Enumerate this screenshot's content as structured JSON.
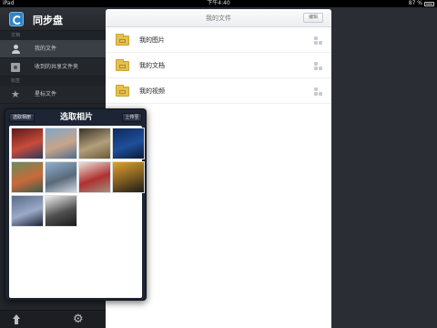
{
  "status_bar": {
    "device": "iPad",
    "time": "下午4:40",
    "battery": "87 %"
  },
  "app": {
    "title": "同步盘"
  },
  "sidebar": {
    "sections": [
      {
        "label": "文档",
        "items": [
          {
            "label": "我的文件",
            "icon": "user-icon",
            "active": true
          },
          {
            "label": "收到的共享文件夹",
            "icon": "shared-folder-icon",
            "active": false
          }
        ]
      },
      {
        "label": "标签",
        "items": [
          {
            "label": "星标文件",
            "icon": "star-icon",
            "active": false
          }
        ]
      }
    ],
    "footer_icons": [
      "upload-icon",
      "settings-icon"
    ]
  },
  "main": {
    "title": "我的文件",
    "edit_label": "编辑",
    "files": [
      {
        "name": "我的图片",
        "icon": "folder-icon"
      },
      {
        "name": "我的文档",
        "icon": "folder-icon"
      },
      {
        "name": "我的视频",
        "icon": "folder-icon"
      }
    ]
  },
  "photo_picker": {
    "title": "选取相片",
    "albums_button": "选取相册",
    "upload_button": "上传至",
    "photos": [
      {
        "name": "photo-1",
        "colors": [
          "#5a1a1a",
          "#c94b3b",
          "#2a3a5a"
        ]
      },
      {
        "name": "photo-2",
        "colors": [
          "#7fa6c9",
          "#c8a58a",
          "#4f6c8a"
        ]
      },
      {
        "name": "photo-3",
        "colors": [
          "#3a3226",
          "#b2a07a",
          "#6a5a3a"
        ]
      },
      {
        "name": "photo-4",
        "colors": [
          "#0f2a5a",
          "#1e4f9a",
          "#0a1a33"
        ]
      },
      {
        "name": "photo-5",
        "colors": [
          "#6a8a5a",
          "#c96a3a",
          "#3a5a4a"
        ]
      },
      {
        "name": "photo-6",
        "colors": [
          "#8fb0d0",
          "#5a6a7a",
          "#d0d8e0"
        ]
      },
      {
        "name": "photo-7",
        "colors": [
          "#e8e2d8",
          "#b03030",
          "#a09080"
        ]
      },
      {
        "name": "photo-8",
        "colors": [
          "#e0a030",
          "#7a5a20",
          "#1a1a1a"
        ]
      },
      {
        "name": "photo-9",
        "colors": [
          "#5a6a8a",
          "#9aaac8",
          "#1a2234"
        ]
      },
      {
        "name": "photo-10",
        "colors": [
          "#f0f0f0",
          "#505050",
          "#1a1a1a"
        ]
      }
    ]
  }
}
